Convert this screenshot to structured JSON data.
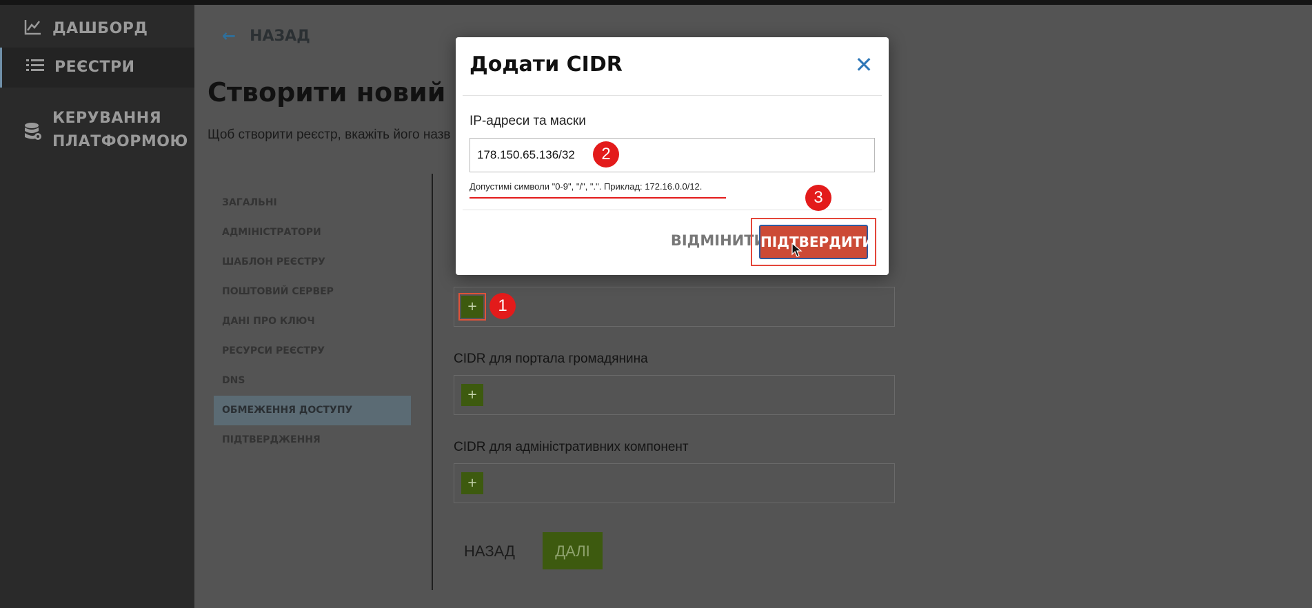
{
  "sidebar": {
    "items": [
      {
        "label": "ДАШБОРД",
        "icon": "chart-icon"
      },
      {
        "label": "РЕЄСТРИ",
        "icon": "list-icon"
      },
      {
        "label": "КЕРУВАННЯ",
        "label_line2": "ПЛАТФОРМОЮ",
        "icon": "database-gear-icon"
      }
    ]
  },
  "header": {
    "back_label": "НАЗАД",
    "title": "Створити новий реєстр",
    "subtitle": "Щоб створити реєстр, вкажіть його назв"
  },
  "steps": [
    "ЗАГАЛЬНІ",
    "АДМІНІСТРАТОРИ",
    "ШАБЛОН РЕЄСТРУ",
    "ПОШТОВИЙ СЕРВЕР",
    "ДАНІ ПРО КЛЮЧ",
    "РЕСУРСИ РЕЄСТРУ",
    "DNS",
    "ОБМЕЖЕННЯ ДОСТУПУ",
    "ПІДТВЕРДЖЕННЯ"
  ],
  "cidr_sections": {
    "citizen_label": "CIDR для портала громадянина",
    "admin_label": "CIDR для адміністративних компонент",
    "add_symbol": "+"
  },
  "footer": {
    "back_label": "НАЗАД",
    "next_label": "ДАЛІ"
  },
  "modal": {
    "title": "Додати CIDR",
    "close_symbol": "✕",
    "ip_label": "IP-адреси та маски",
    "ip_value": "178.150.65.136/32",
    "hint": "Допустимі символи \"0-9\", \"/\", \".\". Приклад: 172.16.0.0/12.",
    "cancel_label": "ВІДМІНИТИ",
    "confirm_label": "ПІДТВЕРДИТИ"
  },
  "markers": [
    "1",
    "2",
    "3"
  ],
  "colors": {
    "accent_green": "#3d5a0f",
    "confirm_red": "#cc4a36",
    "marker_red": "#e31b1b",
    "link_blue": "#2f78b8"
  }
}
